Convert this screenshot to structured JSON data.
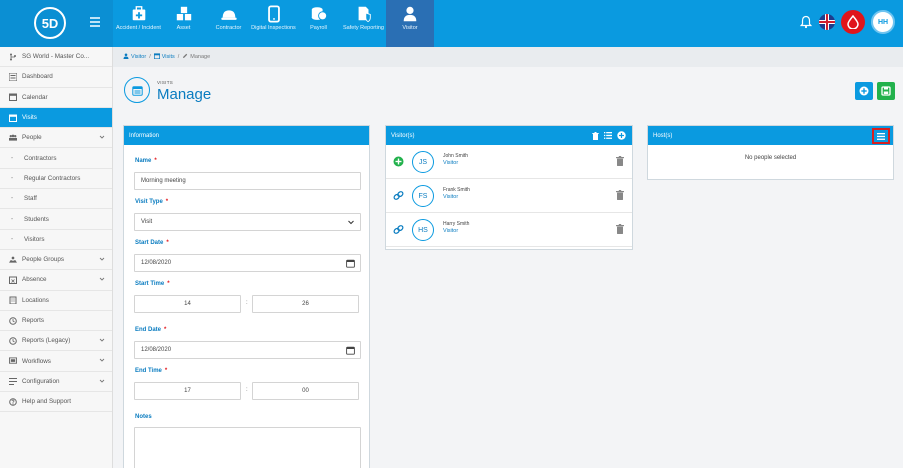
{
  "app": {
    "logo_text": "5D",
    "user_initials": "HH"
  },
  "modules": [
    {
      "label": "Accident / Incident",
      "icon": "first-aid-icon"
    },
    {
      "label": "Asset",
      "icon": "boxes-icon"
    },
    {
      "label": "Contractor",
      "icon": "hard-hat-icon"
    },
    {
      "label": "Digital Inspections",
      "icon": "tablet-icon"
    },
    {
      "label": "Payroll",
      "icon": "coins-icon"
    },
    {
      "label": "Safety Reporting",
      "icon": "shield-file-icon"
    },
    {
      "label": "Visitor",
      "icon": "person-icon"
    }
  ],
  "sidebar": {
    "org": "SG World - Master Co...",
    "items": [
      {
        "label": "Dashboard",
        "icon": "dashboard-icon",
        "sub": false,
        "chev": false
      },
      {
        "label": "Calendar",
        "icon": "calendar-icon",
        "sub": false,
        "chev": false
      },
      {
        "label": "Visits",
        "icon": "calendar-check-icon",
        "sub": false,
        "chev": false,
        "active": true
      },
      {
        "label": "People",
        "icon": "people-icon",
        "sub": false,
        "chev": true
      },
      {
        "label": "Contractors",
        "icon": "dash-icon",
        "sub": true,
        "chev": false
      },
      {
        "label": "Regular Contractors",
        "icon": "dash-icon",
        "sub": true,
        "chev": false
      },
      {
        "label": "Staff",
        "icon": "dash-icon",
        "sub": true,
        "chev": false
      },
      {
        "label": "Students",
        "icon": "dash-icon",
        "sub": true,
        "chev": false
      },
      {
        "label": "Visitors",
        "icon": "dash-icon",
        "sub": true,
        "chev": false
      },
      {
        "label": "People Groups",
        "icon": "people-groups-icon",
        "sub": false,
        "chev": true
      },
      {
        "label": "Absence",
        "icon": "absence-icon",
        "sub": false,
        "chev": true
      },
      {
        "label": "Locations",
        "icon": "building-icon",
        "sub": false,
        "chev": false
      },
      {
        "label": "Reports",
        "icon": "reports-icon",
        "sub": false,
        "chev": false
      },
      {
        "label": "Reports (Legacy)",
        "icon": "reports-legacy-icon",
        "sub": false,
        "chev": true
      },
      {
        "label": "Workflows",
        "icon": "workflow-icon",
        "sub": false,
        "chev": true
      },
      {
        "label": "Configuration",
        "icon": "config-icon",
        "sub": false,
        "chev": true
      },
      {
        "label": "Help and Support",
        "icon": "help-icon",
        "sub": false,
        "chev": false
      }
    ]
  },
  "breadcrumb": {
    "items": [
      "Visitor",
      "Visits",
      "Manage"
    ],
    "sep": "/"
  },
  "page": {
    "subtitle": "VISITS",
    "title": "Manage"
  },
  "info_panel": {
    "title": "Information",
    "name_label": "Name",
    "name_value": "Morning meeting",
    "visit_type_label": "Visit Type",
    "visit_type_value": "Visit",
    "start_date_label": "Start Date",
    "start_date_value": "12/08/2020",
    "start_time_label": "Start Time",
    "start_hour": "14",
    "start_min": "26",
    "end_date_label": "End Date",
    "end_date_value": "12/08/2020",
    "end_time_label": "End Time",
    "end_hour": "17",
    "end_min": "00",
    "notes_label": "Notes",
    "required_mark": "*",
    "time_sep": ":"
  },
  "visitors_panel": {
    "title": "Visitor(s)",
    "rows": [
      {
        "initials": "JS",
        "name": "John Smith",
        "role": "Visitor",
        "lead": "plus"
      },
      {
        "initials": "FS",
        "name": "Frank Smith",
        "role": "Visitor",
        "lead": "link"
      },
      {
        "initials": "HS",
        "name": "Harry Smith",
        "role": "Visitor",
        "lead": "link"
      }
    ]
  },
  "hosts_panel": {
    "title": "Host(s)",
    "empty_text": "No people selected"
  },
  "colors": {
    "primary": "#0a9ae0",
    "accent_green": "#22b14c",
    "alert_red": "#e0151b"
  }
}
